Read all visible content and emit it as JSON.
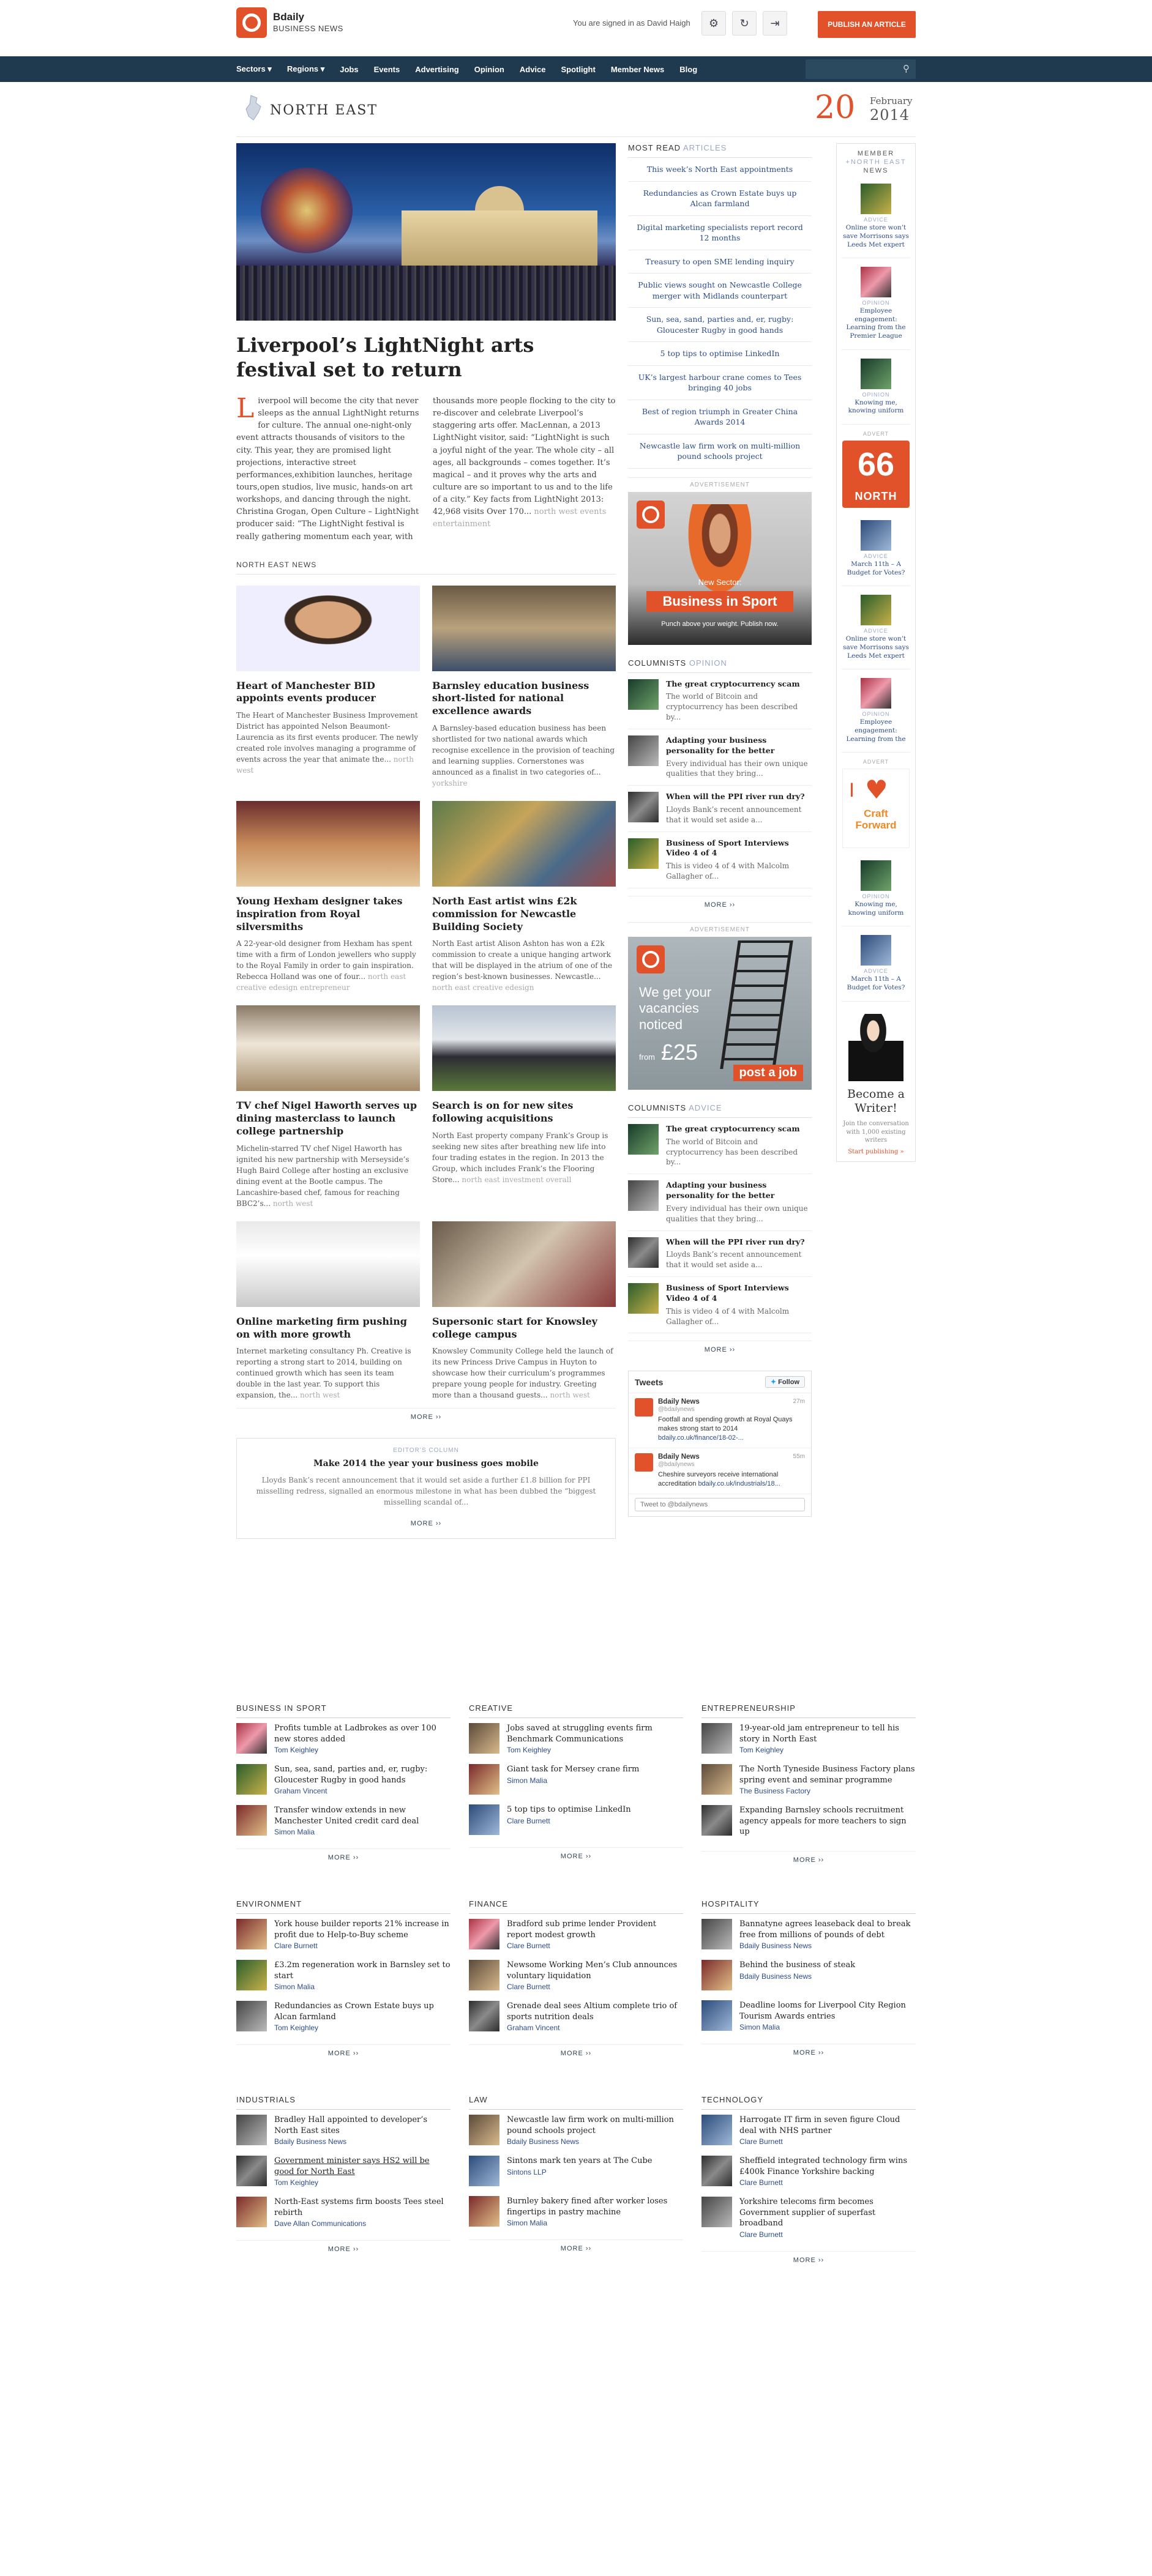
{
  "header": {
    "brand": "Bdaily",
    "brand_sub": "BUSINESS NEWS",
    "signed_in": "You are signed in as David Haigh",
    "publish_label": "PUBLISH AN ARTICLE"
  },
  "nav": {
    "items": [
      "Sectors ▾",
      "Regions ▾",
      "Jobs",
      "Events",
      "Advertising",
      "Opinion",
      "Advice",
      "Spotlight",
      "Member News",
      "Blog"
    ]
  },
  "region": {
    "name": "NORTH EAST",
    "date_day": "20",
    "date_month": "February",
    "date_year": "2014"
  },
  "hero": {
    "title": "Liverpool’s LightNight arts festival set to return",
    "drop": "L",
    "body": "iverpool will become the city that never sleeps as the annual LightNight returns for culture. The annual one-night-only event attracts thousands of visitors to the city. This year, they are promised light projections, interactive street performances,exhibition launches, heritage tours,open studios, live music, hands-on art workshops, and dancing through the night. Christina Grogan, Open Culture – LightNight producer said: “The LightNight festival is really gathering momentum each year, with thousands more people flocking to the city to re-discover and celebrate Liverpool’s staggering arts offer. MacLennan, a 2013 LightNight visitor, said: “LightNight is such a joyful night of the year. The whole city – all ages, all backgrounds – comes together. It’s magical – and it proves why the arts and culture are so important to us and to the life of a city.” Key facts from LightNight 2013: 42,968 visits Over 170...",
    "tags": "north west events entertainment"
  },
  "north_east": {
    "label": "NORTH EAST NEWS",
    "cards": [
      {
        "title": "Heart of Manchester BID appoints events producer",
        "body": "The Heart of Manchester Business Improvement District has appointed Nelson Beaumont-Laurencia as its first events producer. The newly created role involves managing a programme of events across the year that animate the...",
        "tags": "north west"
      },
      {
        "title": "Barnsley education business short-listed for national excellence awards",
        "body": "A Barnsley-based education business has been shortlisted for two national awards which recognise excellence in the provision of teaching and learning supplies. Cornerstones was announced as a finalist in two categories of...",
        "tags": "yorkshire"
      },
      {
        "title": "Young Hexham designer takes inspiration from Royal silversmiths",
        "body": "A 22-year-old designer from Hexham has spent time with a firm of London jewellers who supply to the Royal Family in order to gain inspiration. Rebecca Holland was one of four...",
        "tags": "north east creative edesign entrepreneur"
      },
      {
        "title": "North East artist wins £2k commission for Newcastle Building Society",
        "body": "North East artist Alison Ashton has won a £2k commission to create a unique hanging artwork that will be displayed in the atrium of one of the region’s best-known businesses. Newcastle...",
        "tags": "north east creative edesign"
      },
      {
        "title": "TV chef Nigel Haworth serves up dining masterclass to launch college partnership",
        "body": "Michelin-starred TV chef Nigel Haworth has ignited his new partnership with Merseyside’s Hugh Baird College after hosting an exclusive dining event at the Bootle campus. The Lancashire-based chef, famous for reaching BBC2’s...",
        "tags": "north west"
      },
      {
        "title": "Search is on for new sites following acquisitions",
        "body": "North East property company Frank’s Group is seeking new sites after breathing new life into four trading estates in the region. In 2013 the Group, which includes Frank’s the Flooring Store...",
        "tags": "north east investment overall"
      },
      {
        "title": "Online marketing firm pushing on with more growth",
        "body": "Internet marketing consultancy Ph. Creative is reporting a strong start to 2014, building on continued growth which has seen its team double in the last year. To support this expansion, the...",
        "tags": "north west"
      },
      {
        "title": "Supersonic start for Knowsley college campus",
        "body": "Knowsley Community College held the launch of its new Princess Drive Campus in Huyton to showcase how their curriculum’s programmes prepare young people for industry. Greeting more than a thousand guests...",
        "tags": "north west"
      }
    ],
    "more": "MORE ››"
  },
  "editors": {
    "label": "EDITOR’S COLUMN",
    "title": "Make 2014 the year your business goes mobile",
    "text": "Lloyds Bank’s recent announcement that it would set aside a further £1.8 billion for PPI misselling redress, signalled an enormous milestone in what has been dubbed the “biggest misselling scandal of...",
    "more": "MORE ››"
  },
  "most_read": {
    "head": "MOST READ",
    "accent": "ARTICLES",
    "items": [
      "This week’s North East appointments",
      "Redundancies as Crown Estate buys up Alcan farmland",
      "Digital marketing specialists report record 12 months",
      "Treasury to open SME lending inquiry",
      "Public views sought on Newcastle College merger with Midlands counterpart",
      "Sun, sea, sand, parties and, er, rugby: Gloucester Rugby in good hands",
      "5 top tips to optimise LinkedIn",
      "UK’s largest harbour crane comes to Tees bringing 40 jobs",
      "Best of region triumph in Greater China Awards 2014",
      "Newcastle law firm work on multi-million pound schools project"
    ]
  },
  "ads": {
    "advert_label": "ADVERTISEMENT",
    "sport_new": "New Sector:",
    "sport_title": "Business in Sport",
    "sport_tag": "Punch above your weight. Publish now.",
    "jobs_text": "We get your vacancies noticed",
    "jobs_from": "from",
    "jobs_price": "£25",
    "jobs_btn": "post a job"
  },
  "columnists_opinion": {
    "head": "COLUMNISTS",
    "accent": "OPINION",
    "items": [
      {
        "title": "The great cryptocurrency scam",
        "text": "The world of Bitcoin and cryptocurrency has been described by..."
      },
      {
        "title": "Adapting your business personality for the better",
        "text": "Every individual has their own unique qualities that they bring..."
      },
      {
        "title": "When will the PPI river run dry?",
        "text": "Lloyds Bank’s recent announcement that it would set aside a..."
      },
      {
        "title": "Business of Sport Interviews Video 4 of 4",
        "text": "This is video 4 of 4 with Malcolm Gallagher of..."
      }
    ],
    "more": "MORE ››"
  },
  "columnists_advice": {
    "head": "COLUMNISTS",
    "accent": "ADVICE",
    "items": [
      {
        "title": "The great cryptocurrency scam",
        "text": "The world of Bitcoin and cryptocurrency has been described by..."
      },
      {
        "title": "Adapting your business personality for the better",
        "text": "Every individual has their own unique qualities that they bring..."
      },
      {
        "title": "When will the PPI river run dry?",
        "text": "Lloyds Bank’s recent announcement that it would set aside a..."
      },
      {
        "title": "Business of Sport Interviews Video 4 of 4",
        "text": "This is video 4 of 4 with Malcolm Gallagher of..."
      }
    ],
    "more": "MORE ››"
  },
  "tweets": {
    "head": "Tweets",
    "follow": "Follow",
    "items": [
      {
        "name": "Bdaily News",
        "handle": "@bdailynews",
        "time": "27m",
        "text": "Footfall and spending growth at Royal Quays makes strong start to 2014",
        "link": "bdaily.co.uk/finance/18-02-..."
      },
      {
        "name": "Bdaily News",
        "handle": "@bdailynews",
        "time": "55m",
        "text": "Cheshire surveyors receive international accreditation",
        "link": "bdaily.co.uk/industrials/18..."
      }
    ],
    "box": "Tweet to @bdailynews"
  },
  "member_news": {
    "head1": "MEMBER",
    "head2": "+NORTH EAST",
    "head3": "NEWS",
    "items1": [
      {
        "tag": "ADVICE",
        "text": "Online store won’t save Morrisons says Leeds Met expert"
      },
      {
        "tag": "OPINION",
        "text": "Employee engagement: Learning from the Premier League"
      },
      {
        "tag": "OPINION",
        "text": "Knowing me, knowing uniform"
      }
    ],
    "advert": "ADVERT",
    "ad66_big": "66",
    "ad66_sub": "NORTH",
    "items2": [
      {
        "tag": "ADVICE",
        "text": "March 11th – A Budget for Votes?"
      },
      {
        "tag": "ADVICE",
        "text": "Online store won’t save Morrisons says Leeds Met expert"
      },
      {
        "tag": "OPINION",
        "text": "Employee engagement: Learning from the"
      }
    ],
    "adcf": "Craft Forward",
    "items3": [
      {
        "tag": "OPINION",
        "text": "Knowing me, knowing uniform"
      },
      {
        "tag": "ADVICE",
        "text": "March 11th – A Budget for Votes?"
      }
    ],
    "writer_title": "Become a Writer!",
    "writer_text": "Join the conversation with 1,000 existing writers",
    "writer_link": "Start publishing »"
  },
  "sectors": [
    {
      "head": "BUSINESS IN SPORT",
      "items": [
        {
          "title": "Profits tumble at Ladbrokes as over 100 new stores added",
          "author": "Tom Keighley"
        },
        {
          "title": "Sun, sea, sand, parties and, er, rugby: Gloucester Rugby in good hands",
          "author": "Graham Vincent"
        },
        {
          "title": "Transfer window extends in new Manchester United credit card deal",
          "author": "Simon Malia"
        }
      ]
    },
    {
      "head": "CREATIVE",
      "items": [
        {
          "title": "Jobs saved at struggling events firm Benchmark Communications",
          "author": "Tom Keighley"
        },
        {
          "title": "Giant task for Mersey crane firm",
          "author": "Simon Malia"
        },
        {
          "title": "5 top tips to optimise LinkedIn",
          "author": "Clare Burnett"
        }
      ]
    },
    {
      "head": "ENTREPRENEURSHIP",
      "items": [
        {
          "title": "19-year-old jam entrepreneur to tell his story in North East",
          "author": "Tom Keighley"
        },
        {
          "title": "The North Tyneside Business Factory plans spring event and seminar programme",
          "author": "The Business Factory"
        },
        {
          "title": "Expanding Barnsley schools recruitment agency appeals for more teachers to sign up",
          "author": ""
        }
      ]
    },
    {
      "head": "ENVIRONMENT",
      "items": [
        {
          "title": "York house builder reports 21% increase in profit due to Help-to-Buy scheme",
          "author": "Clare Burnett"
        },
        {
          "title": "£3.2m regeneration work in Barnsley set to start",
          "author": "Simon Malia"
        },
        {
          "title": "Redundancies as Crown Estate buys up Alcan farmland",
          "author": "Tom Keighley"
        }
      ]
    },
    {
      "head": "FINANCE",
      "items": [
        {
          "title": "Bradford sub prime lender Provident report modest growth",
          "author": "Clare Burnett"
        },
        {
          "title": "Newsome Working Men’s Club announces voluntary liquidation",
          "author": "Clare Burnett"
        },
        {
          "title": "Grenade deal sees Altium complete trio of sports nutrition deals",
          "author": "Graham Vincent"
        }
      ]
    },
    {
      "head": "HOSPITALITY",
      "items": [
        {
          "title": "Bannatyne agrees leaseback deal to break free from millions of pounds of debt",
          "author": "Bdaily Business News"
        },
        {
          "title": "Behind the business of steak",
          "author": "Bdaily Business News"
        },
        {
          "title": "Deadline looms for Liverpool City Region Tourism Awards entries",
          "author": "Simon Malia"
        }
      ]
    },
    {
      "head": "INDUSTRIALS",
      "items": [
        {
          "title": "Bradley Hall appointed to developer’s North East sites",
          "author": "Bdaily Business News"
        },
        {
          "title": "Government minister says HS2 will be good for North East",
          "author": "Tom Keighley"
        },
        {
          "title": "North-East systems firm boosts Tees steel rebirth",
          "author": "Dave Allan Communications"
        }
      ]
    },
    {
      "head": "LAW",
      "items": [
        {
          "title": "Newcastle law firm work on multi-million pound schools project",
          "author": "Bdaily Business News"
        },
        {
          "title": "Sintons mark ten years at The Cube",
          "author": "Sintons LLP"
        },
        {
          "title": "Burnley bakery fined after worker loses fingertips in pastry machine",
          "author": "Simon Malia"
        }
      ]
    },
    {
      "head": "TECHNOLOGY",
      "items": [
        {
          "title": "Harrogate IT firm in seven figure Cloud deal with NHS partner",
          "author": "Clare Burnett"
        },
        {
          "title": "Sheffield integrated technology firm wins £400k Finance Yorkshire backing",
          "author": "Clare Burnett"
        },
        {
          "title": "Yorkshire telecoms firm becomes Government supplier of superfast broadband",
          "author": "Clare Burnett"
        }
      ]
    }
  ],
  "sector_more": "MORE ››"
}
